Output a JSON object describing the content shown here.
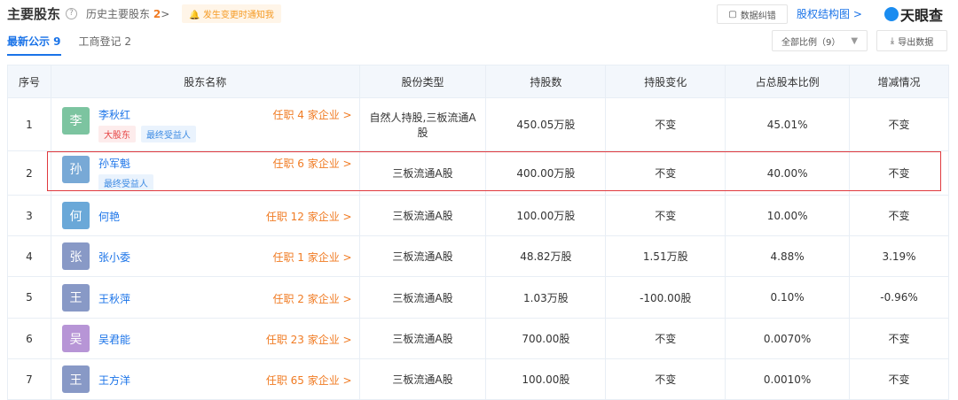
{
  "header": {
    "title": "主要股东",
    "help_icon": "?",
    "history_label": "历史主要股东",
    "history_count": "2",
    "history_chevron": ">",
    "notify_label": "发生变更时通知我",
    "error_btn": "数据纠错",
    "structure_link": "股权结构图 >",
    "logo_text": "天眼查",
    "filter_label": "全部比例（9）",
    "filter_arrow": "▼",
    "export_label": "导出数据"
  },
  "tabs": [
    {
      "label": "最新公示 9"
    },
    {
      "label": "工商登记 2"
    }
  ],
  "table": {
    "columns": [
      "序号",
      "股东名称",
      "股份类型",
      "持股数",
      "持股变化",
      "占总股本比例",
      "增减情况"
    ],
    "rows": [
      {
        "no": "1",
        "avatar": "李",
        "avatar_color": "#7cc4a0",
        "name": "李秋红",
        "jobs": "任职 4 家企业 >",
        "tags": [
          "大股东",
          "最终受益人"
        ],
        "type": "自然人持股,三板流通A股",
        "shares": "450.05万股",
        "change": "不变",
        "ratio": "45.01%",
        "delta": "不变"
      },
      {
        "no": "2",
        "avatar": "孙",
        "avatar_color": "#78a9d6",
        "name": "孙军魁",
        "jobs": "任职 6 家企业 >",
        "tags": [
          "最终受益人"
        ],
        "type": "三板流通A股",
        "shares": "400.00万股",
        "change": "不变",
        "ratio": "40.00%",
        "delta": "不变"
      },
      {
        "no": "3",
        "avatar": "何",
        "avatar_color": "#6aa8d8",
        "name": "何艳",
        "jobs": "任职 12 家企业 >",
        "tags": [],
        "type": "三板流通A股",
        "shares": "100.00万股",
        "change": "不变",
        "ratio": "10.00%",
        "delta": "不变"
      },
      {
        "no": "4",
        "avatar": "张",
        "avatar_color": "#8899c6",
        "name": "张小委",
        "jobs": "任职 1 家企业 >",
        "tags": [],
        "type": "三板流通A股",
        "shares": "48.82万股",
        "change": "1.51万股",
        "ratio": "4.88%",
        "delta": "3.19%"
      },
      {
        "no": "5",
        "avatar": "王",
        "avatar_color": "#8899c6",
        "name": "王秋萍",
        "jobs": "任职 2 家企业 >",
        "tags": [],
        "type": "三板流通A股",
        "shares": "1.03万股",
        "change": "-100.00股",
        "ratio": "0.10%",
        "delta": "-0.96%"
      },
      {
        "no": "6",
        "avatar": "吴",
        "avatar_color": "#b795d6",
        "name": "吴君能",
        "jobs": "任职 23 家企业 >",
        "tags": [],
        "type": "三板流通A股",
        "shares": "700.00股",
        "change": "不变",
        "ratio": "0.0070%",
        "delta": "不变"
      },
      {
        "no": "7",
        "avatar": "王",
        "avatar_color": "#8899c6",
        "name": "王方洋",
        "jobs": "任职 65 家企业 >",
        "tags": [],
        "type": "三板流通A股",
        "shares": "100.00股",
        "change": "不变",
        "ratio": "0.0010%",
        "delta": "不变"
      }
    ]
  }
}
